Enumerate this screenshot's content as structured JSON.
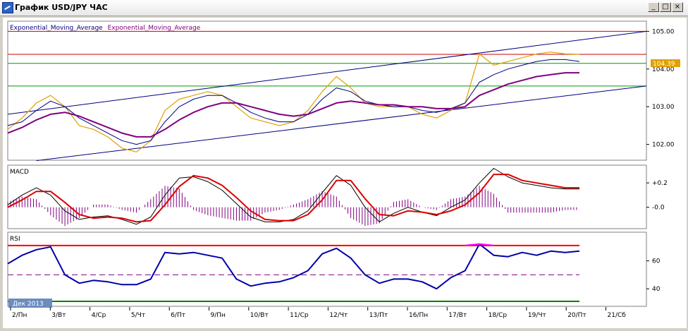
{
  "window": {
    "title": "График USD/JPY ЧАС",
    "buttons": {
      "minimize": "_",
      "maximize": "□",
      "close": "×"
    }
  },
  "colors": {
    "price": "#e0a000",
    "ema_fast": "#000080",
    "ema_slow": "#800080",
    "channel": "#000080",
    "resistance": "#cc0000",
    "support_green": "#009900",
    "macd_main": "#000000",
    "macd_signal": "#dd0000",
    "macd_hist": "#800080",
    "rsi": "#0000aa",
    "rsi_overbought": "#ff00ff",
    "rsi_level_hi": "#ff0000",
    "rsi_level_mid": "#800080",
    "rsi_level_lo": "#008000",
    "price_tag_bg": "#e0a000"
  },
  "chart_data": [
    {
      "panel": "price",
      "type": "line",
      "legend_text": [
        "Exponential_Moving_Average",
        "Exponential_Moving_Average"
      ],
      "current_price": "104.39",
      "y_ticks": [
        "105.00",
        "104.00",
        "103.00",
        "102.00"
      ],
      "ylim": [
        101.6,
        105.25
      ],
      "hlines": [
        105.0,
        104.39,
        104.15,
        103.55
      ],
      "channel_upper": [
        [
          0,
          102.8
        ],
        [
          200,
          105.0
        ]
      ],
      "channel_lower": [
        [
          10,
          101.57
        ],
        [
          200,
          103.55
        ]
      ],
      "x": [
        0,
        5,
        10,
        15,
        20,
        25,
        30,
        35,
        40,
        45,
        50,
        55,
        60,
        65,
        70,
        75,
        80,
        85,
        90,
        95,
        100,
        105,
        110,
        115,
        120,
        125,
        130,
        135,
        140,
        145,
        150,
        155,
        160,
        165,
        170,
        175,
        180,
        185,
        190,
        195,
        200
      ],
      "series": [
        {
          "name": "price",
          "values": [
            102.4,
            102.7,
            103.1,
            103.3,
            103.0,
            102.5,
            102.4,
            102.2,
            101.9,
            101.8,
            102.1,
            102.9,
            103.2,
            103.3,
            103.4,
            103.3,
            103.0,
            102.7,
            102.6,
            102.5,
            102.6,
            102.9,
            103.4,
            103.8,
            103.5,
            103.1,
            103.0,
            103.0,
            103.0,
            102.8,
            102.7,
            102.9,
            103.1,
            104.4,
            104.1,
            104.2,
            104.3,
            104.4,
            104.45,
            104.4,
            104.39
          ]
        },
        {
          "name": "ema_fast",
          "values": [
            102.5,
            102.6,
            102.9,
            103.15,
            103.0,
            102.7,
            102.5,
            102.3,
            102.1,
            102.0,
            102.1,
            102.6,
            103.0,
            103.2,
            103.3,
            103.3,
            103.1,
            102.85,
            102.7,
            102.6,
            102.6,
            102.8,
            103.2,
            103.5,
            103.4,
            103.15,
            103.05,
            103.0,
            103.0,
            102.9,
            102.85,
            102.95,
            103.1,
            103.65,
            103.85,
            104.0,
            104.1,
            104.2,
            104.25,
            104.25,
            104.2
          ]
        },
        {
          "name": "ema_slow",
          "values": [
            102.3,
            102.45,
            102.65,
            102.8,
            102.85,
            102.75,
            102.6,
            102.45,
            102.3,
            102.2,
            102.2,
            102.4,
            102.65,
            102.85,
            103.0,
            103.1,
            103.1,
            103.0,
            102.9,
            102.8,
            102.75,
            102.8,
            102.95,
            103.1,
            103.15,
            103.1,
            103.05,
            103.05,
            103.0,
            103.0,
            102.95,
            102.95,
            103.0,
            103.3,
            103.45,
            103.6,
            103.7,
            103.8,
            103.85,
            103.9,
            103.9
          ]
        }
      ]
    },
    {
      "panel": "macd",
      "type": "line",
      "title": "MACD",
      "y_ticks": [
        "+0.2",
        "-0.0"
      ],
      "ylim": [
        -0.17,
        0.34
      ],
      "x": [
        0,
        5,
        10,
        15,
        20,
        25,
        30,
        35,
        40,
        45,
        50,
        55,
        60,
        65,
        70,
        75,
        80,
        85,
        90,
        95,
        100,
        105,
        110,
        115,
        120,
        125,
        130,
        135,
        140,
        145,
        150,
        155,
        160,
        165,
        170,
        175,
        180,
        185,
        190,
        195,
        200
      ],
      "series": [
        {
          "name": "macd",
          "values": [
            0.02,
            0.1,
            0.16,
            0.1,
            -0.03,
            -0.1,
            -0.08,
            -0.07,
            -0.1,
            -0.14,
            -0.08,
            0.1,
            0.24,
            0.25,
            0.21,
            0.14,
            0.03,
            -0.08,
            -0.12,
            -0.12,
            -0.1,
            -0.03,
            0.12,
            0.26,
            0.18,
            0.0,
            -0.12,
            -0.05,
            0.0,
            -0.04,
            -0.07,
            0.0,
            0.06,
            0.2,
            0.32,
            0.25,
            0.2,
            0.18,
            0.16,
            0.15,
            0.15
          ]
        },
        {
          "name": "signal",
          "values": [
            0.0,
            0.06,
            0.13,
            0.13,
            0.04,
            -0.06,
            -0.09,
            -0.08,
            -0.09,
            -0.12,
            -0.11,
            0.02,
            0.17,
            0.26,
            0.24,
            0.18,
            0.08,
            -0.03,
            -0.1,
            -0.11,
            -0.11,
            -0.06,
            0.06,
            0.22,
            0.22,
            0.07,
            -0.06,
            -0.07,
            -0.03,
            -0.04,
            -0.06,
            -0.03,
            0.02,
            0.12,
            0.27,
            0.27,
            0.22,
            0.2,
            0.18,
            0.16,
            0.16
          ]
        }
      ]
    },
    {
      "panel": "rsi",
      "type": "line",
      "title": "RSI",
      "y_ticks": [
        "60",
        "40"
      ],
      "ylim": [
        28,
        80
      ],
      "levels": [
        71,
        50,
        31
      ],
      "x": [
        0,
        5,
        10,
        15,
        20,
        25,
        30,
        35,
        40,
        45,
        50,
        55,
        60,
        65,
        70,
        75,
        80,
        85,
        90,
        95,
        100,
        105,
        110,
        115,
        120,
        125,
        130,
        135,
        140,
        145,
        150,
        155,
        160,
        165,
        170,
        175,
        180,
        185,
        190,
        195,
        200
      ],
      "series": [
        {
          "name": "rsi",
          "values": [
            58,
            64,
            68,
            70,
            50,
            44,
            46,
            45,
            43,
            43,
            47,
            66,
            65,
            66,
            64,
            62,
            47,
            42,
            44,
            45,
            48,
            53,
            65,
            69,
            62,
            50,
            44,
            47,
            47,
            45,
            40,
            48,
            53,
            72,
            64,
            63,
            66,
            64,
            67,
            66,
            67
          ]
        }
      ]
    }
  ],
  "x_axis": {
    "labels": [
      "2/Пн",
      "3/Вт",
      "4/Ср",
      "5/Чт",
      "6/Пт",
      "9/Пн",
      "10/Вт",
      "11/Ср",
      "12/Чт",
      "13/Пт",
      "16/Пн",
      "17/Вт",
      "18/Ср",
      "19/Чт",
      "20/Пт",
      "21/Сб"
    ],
    "period_label": "Дек 2013"
  }
}
